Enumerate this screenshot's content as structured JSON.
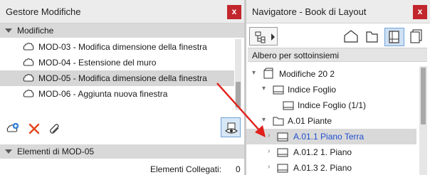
{
  "left_panel": {
    "title": "Gestore Modifiche",
    "close_label": "x",
    "changes_section": "Modifiche",
    "changes": [
      {
        "label": "MOD-03 - Modifica dimensione della finestra",
        "selected": false
      },
      {
        "label": "MOD-04 - Estensione del muro",
        "selected": false
      },
      {
        "label": "MOD-05 - Modifica dimensione della finestra",
        "selected": true
      },
      {
        "label": "MOD-06 - Aggiunta nuova finestra",
        "selected": false
      }
    ],
    "elements_section": "Elementi di MOD-05",
    "linked_elements_label": "Elementi Collegati:",
    "linked_elements_count": "0"
  },
  "right_panel": {
    "title": "Navigatore - Book di Layout",
    "close_label": "x",
    "view_mode": "Albero per sottoinsiemi",
    "tree": [
      {
        "label": "Modifiche 20 2",
        "arrow": "▾",
        "highlighted": false,
        "selected": false
      },
      {
        "label": "Indice Foglio",
        "arrow": "▾",
        "highlighted": false,
        "selected": false
      },
      {
        "label": "Indice Foglio (1/1)",
        "arrow": "",
        "highlighted": false,
        "selected": false
      },
      {
        "label": "A.01 Piante",
        "arrow": "▾",
        "highlighted": false,
        "selected": false
      },
      {
        "label": "A.01.1 Piano Terra",
        "arrow": "›",
        "highlighted": true,
        "selected": true
      },
      {
        "label": "A.01.2 1. Piano",
        "arrow": "›",
        "highlighted": false,
        "selected": false
      },
      {
        "label": "A.01.3 2. Piano",
        "arrow": "›",
        "highlighted": false,
        "selected": false
      }
    ]
  },
  "colors": {
    "accent_blue": "#1f4fd0",
    "close_red": "#c1272d",
    "pointer_arrow_red": "#e0201b",
    "toggle_blue": "#6da2d6"
  },
  "icons": {
    "change_item": "cloud-revision-icon",
    "new_change": "add-revision-icon",
    "delete": "red-x-delete-icon",
    "link": "paperclip-icon",
    "show_on_screen": "eye-view-icon",
    "tree_root": "layout-book-icon",
    "subset": "subset-folder-icon",
    "layout_sheet": "layout-sheet-icon"
  }
}
